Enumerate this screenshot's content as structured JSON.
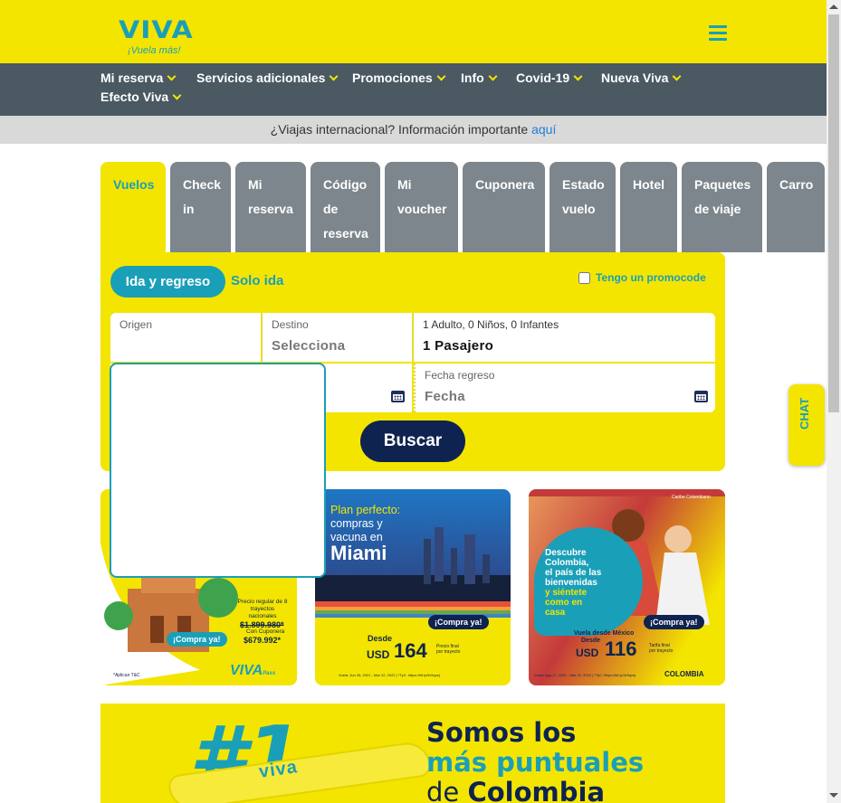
{
  "header": {
    "logo_word": "VIVA",
    "logo_tagline": "¡Vuela más!"
  },
  "nav": {
    "items": [
      "Mi reserva",
      "Servicios adicionales",
      "Promociones",
      "Info",
      "Covid-19",
      "Nueva Viva",
      "Efecto Viva"
    ]
  },
  "notice": {
    "text": "¿Viajas internacional? Información importante ",
    "link": "aquí"
  },
  "tabs": [
    {
      "lines": [
        "Vuelos"
      ]
    },
    {
      "lines": [
        "Check",
        "in"
      ]
    },
    {
      "lines": [
        "Mi",
        "reserva"
      ]
    },
    {
      "lines": [
        "Código",
        "de",
        "reserva"
      ]
    },
    {
      "lines": [
        "Mi",
        "voucher"
      ]
    },
    {
      "lines": [
        "Cuponera"
      ]
    },
    {
      "lines": [
        "Estado",
        "vuelo"
      ]
    },
    {
      "lines": [
        "Hotel"
      ]
    },
    {
      "lines": [
        "Paquetes",
        "de viaje"
      ]
    },
    {
      "lines": [
        "Carro"
      ]
    }
  ],
  "search": {
    "trip_round": "Ida y regreso",
    "trip_oneway": "Solo ida",
    "promo_label": "Tengo un promocode",
    "origin_label": "Origen",
    "origin_value": "",
    "destination_label": "Destino",
    "destination_value": "Selecciona",
    "passengers_label": "1 Adulto, 0 Niños, 0 Infantes",
    "passengers_value": "1 Pasajero",
    "return_label": "Fecha regreso",
    "return_value": "Fecha",
    "button": "Buscar"
  },
  "banners": [
    {
      "price_label": "Precio regular de 8 trayectos nacionales",
      "old_price": "$1.899.980*",
      "coupon_label": "Con Cuponera",
      "new_price": "$679.992*",
      "cta": "¡Compra ya!",
      "note": "*Aplican T&C",
      "brand": "VIVA",
      "brand_sub": "Pass"
    },
    {
      "title_1": "Plan perfecto:",
      "title_2": "compras y",
      "title_3": "vacuna en",
      "city": "Miami",
      "cta": "¡Compra ya!",
      "from": "Desde",
      "currency": "USD",
      "price": "164",
      "price_note": "Precio final por trayecto",
      "fine_print": "Vuela: Jun 26, 2021 - Mar 22, 2022 | *TyC: https://bit.ly/3v9qcej"
    },
    {
      "corner": "Caribe Colombiano",
      "title": [
        "Descubre",
        "Colombia,",
        "el país de las",
        "bienvenidas"
      ],
      "title_accent": [
        "y siéntete",
        "como en",
        "casa"
      ],
      "cta": "¡Compra ya!",
      "from": "Vuela desde México",
      "from_2": "Desde",
      "currency": "USD",
      "price": "116",
      "price_note": "Tarifa final por trayecto",
      "fine_print": "Vuela: Ago 17, 2021 - Mar 22, 2022 | *TyC: https://bit.ly/3v9qcej",
      "brand": "COLOMBIA"
    }
  ],
  "promo_banner": {
    "hash": "#1",
    "line1": "Somos los",
    "line2": "más puntuales",
    "line3_a": "de ",
    "line3_b": "Colombia",
    "plane_logo": "viva"
  },
  "chat": {
    "label": "CHAT"
  },
  "colors": {
    "brand_yellow": "#f3e500",
    "brand_teal": "#1a9fb8",
    "nav_gray": "#4a5962",
    "tab_gray": "#7d868c",
    "navy": "#0f2351"
  }
}
